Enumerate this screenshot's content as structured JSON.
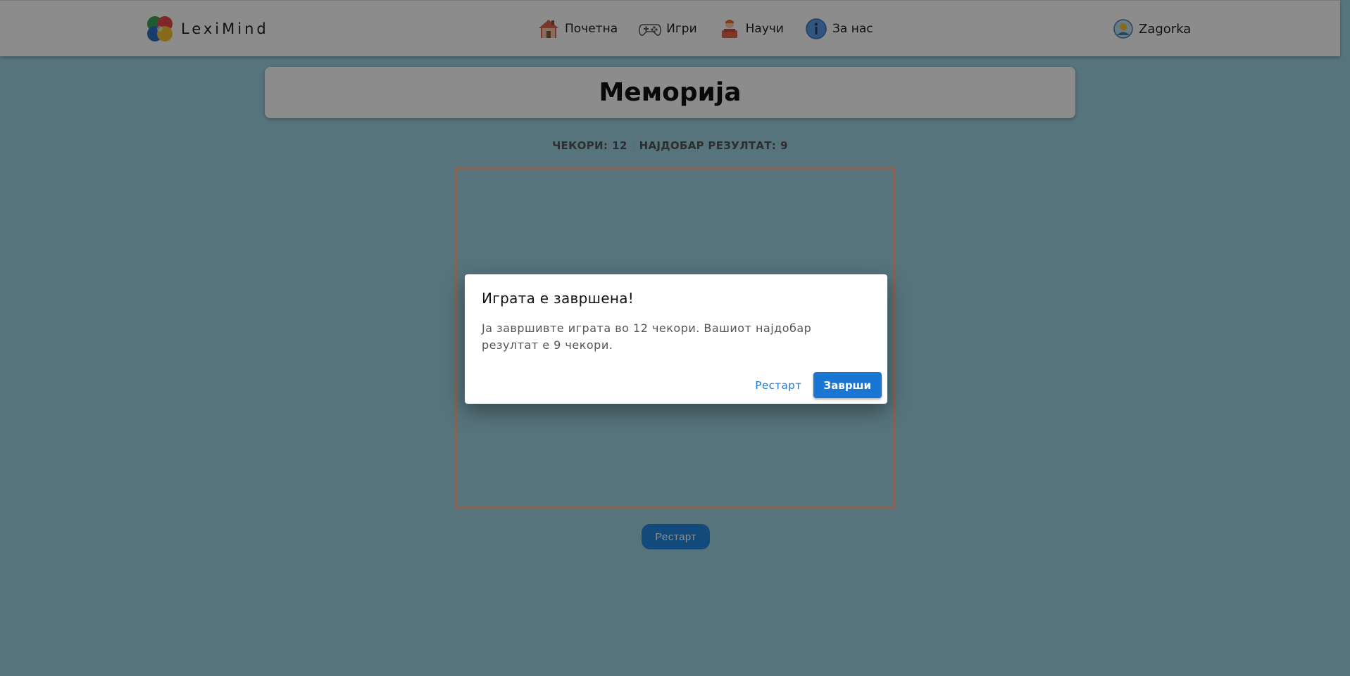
{
  "header": {
    "brand": "LexiMind",
    "nav": [
      {
        "label": "Почетна",
        "icon": "house-icon"
      },
      {
        "label": "Игри",
        "icon": "gamepad-icon"
      },
      {
        "label": "Научи",
        "icon": "learner-icon"
      },
      {
        "label": "За нас",
        "icon": "info-icon"
      }
    ],
    "user": "Zagorka"
  },
  "page": {
    "title": "Меморија",
    "moves_label": "ЧЕКОРИ:",
    "moves_value": "12",
    "best_label": "НАЈДОБАР РЕЗУЛТАТ:",
    "best_value": "9",
    "restart_label": "Рестарт"
  },
  "dialog": {
    "title": "Играта е завршена!",
    "message": "Ја завршивте играта во 12 чекори. Вашиот најдобар резултат е 9 чекори.",
    "restart_label": "Рестарт",
    "finish_label": "Заврши"
  },
  "colors": {
    "page_background": "#9fd3e3",
    "accent": "#1976d2",
    "board_border": "#f1b9a1"
  }
}
